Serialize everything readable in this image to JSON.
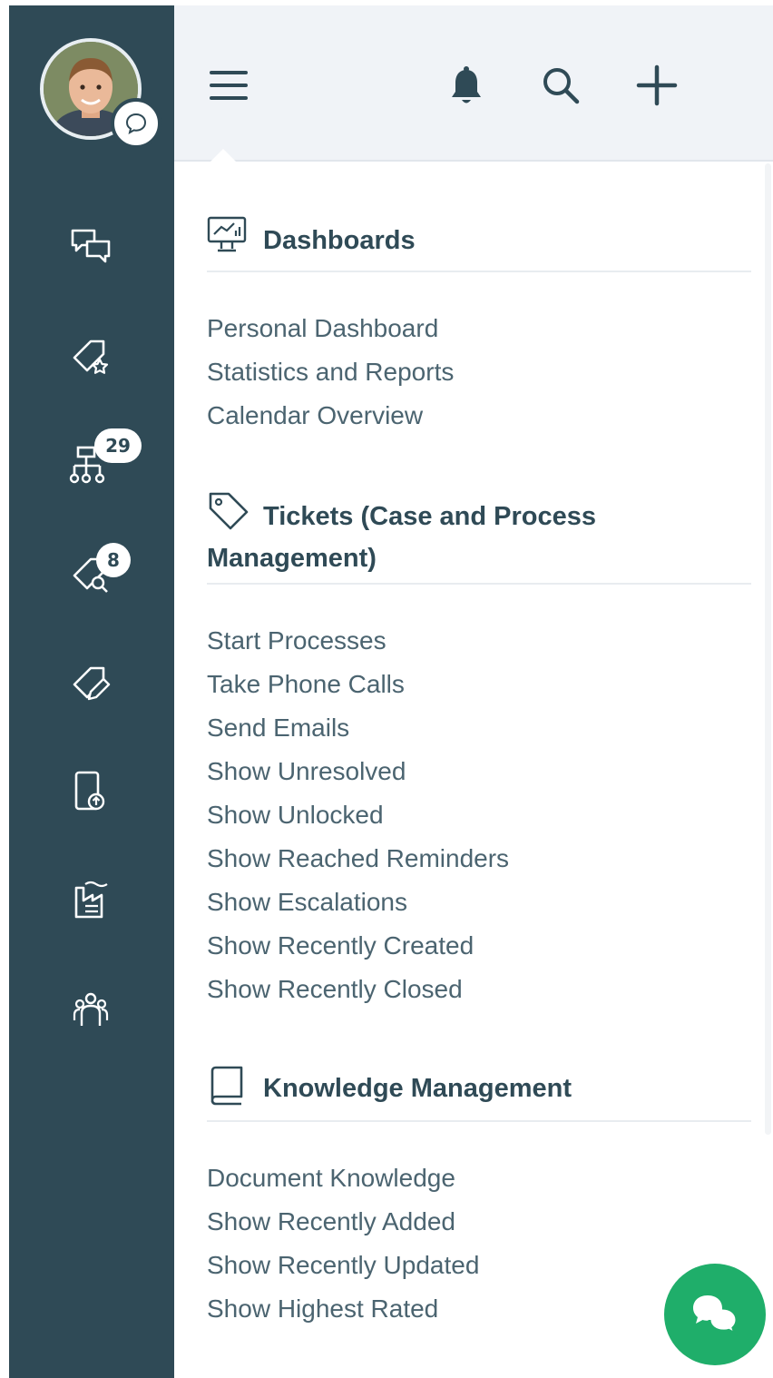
{
  "sidebar": {
    "tickets_count": "29",
    "search_count": "8",
    "icons": [
      "chat-icon",
      "tag-star-icon",
      "org-tree-icon",
      "tag-search-icon",
      "tag-edit-icon",
      "phone-upload-icon",
      "factory-icon",
      "team-icon"
    ]
  },
  "header": {
    "icons": [
      "hamburger-icon",
      "bell-icon",
      "search-icon",
      "plus-icon"
    ]
  },
  "menu": {
    "dashboards": {
      "title": "Dashboards",
      "items": [
        "Personal Dashboard",
        "Statistics and Reports",
        "Calendar Overview"
      ]
    },
    "tickets": {
      "title_line1": "Tickets (Case and Process",
      "title_line2": "Management)",
      "items": [
        "Start Processes",
        "Take Phone Calls",
        "Send Emails",
        "Show Unresolved",
        "Show Unlocked",
        "Show Reached Reminders",
        "Show Escalations",
        "Show Recently Created",
        "Show Recently Closed"
      ]
    },
    "knowledge": {
      "title": "Knowledge Management",
      "items": [
        "Document Knowledge",
        "Show Recently Added",
        "Show Recently Updated",
        "Show Highest Rated"
      ]
    }
  },
  "colors": {
    "sidebar": "#2f4a56",
    "header": "#f0f3f7",
    "accent": "#1fae6a",
    "text": "#4b6470"
  }
}
